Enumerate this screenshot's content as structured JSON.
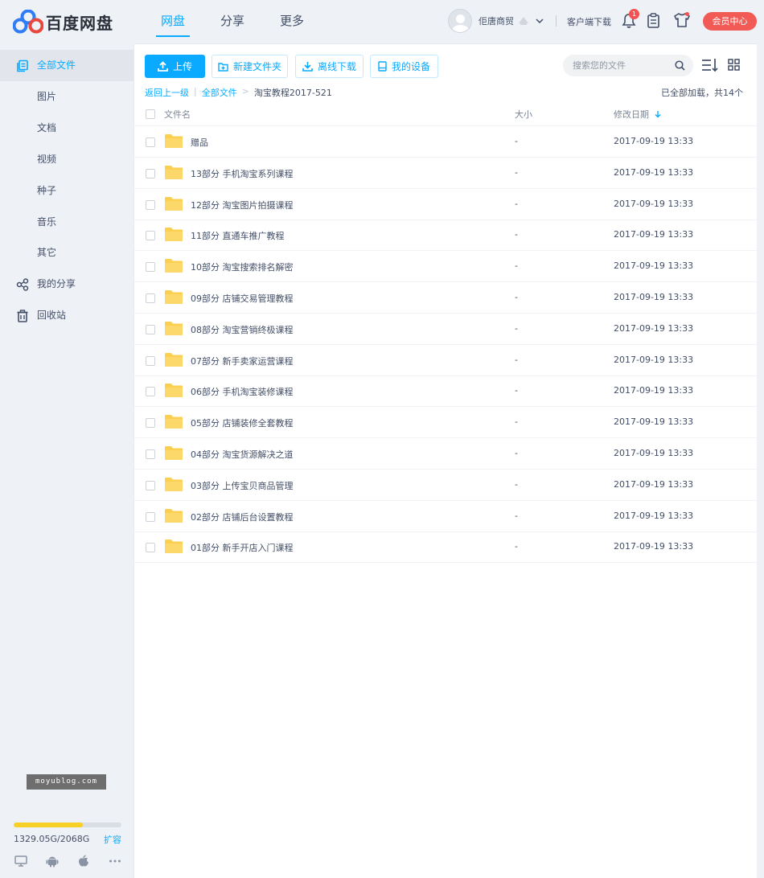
{
  "app": {
    "name": "百度网盘"
  },
  "nav": [
    {
      "label": "网盘"
    },
    {
      "label": "分享"
    },
    {
      "label": "更多"
    }
  ],
  "user": {
    "name": "佢唐商贸",
    "client_download": "客户端下载",
    "notification_count": "1",
    "vip_button": "会员中心"
  },
  "sidebar": {
    "items": [
      {
        "label": "全部文件",
        "icon": "all-files-icon",
        "active": true
      },
      {
        "label": "图片"
      },
      {
        "label": "文档"
      },
      {
        "label": "视频"
      },
      {
        "label": "种子"
      },
      {
        "label": "音乐"
      },
      {
        "label": "其它"
      },
      {
        "label": "我的分享",
        "icon": "share-icon"
      },
      {
        "label": "回收站",
        "icon": "trash-icon"
      }
    ],
    "watermark": "moyublog.com",
    "quota": {
      "text": "1329.05G/2068G",
      "used_fraction": 0.643,
      "expand_label": "扩容"
    }
  },
  "toolbar": {
    "upload": "上传",
    "new_folder": "新建文件夹",
    "offline_download": "离线下载",
    "my_devices": "我的设备",
    "search_placeholder": "搜索您的文件"
  },
  "breadcrumb": {
    "back": "返回上一级",
    "root": "全部文件",
    "current": "淘宝教程2017-521"
  },
  "status": {
    "loaded": "已全部加载，共14个"
  },
  "table": {
    "headers": {
      "name": "文件名",
      "size": "大小",
      "date": "修改日期"
    },
    "rows": [
      {
        "name": "赠品",
        "size": "-",
        "date": "2017-09-19 13:33"
      },
      {
        "name": "13部分 手机淘宝系列课程",
        "size": "-",
        "date": "2017-09-19 13:33"
      },
      {
        "name": "12部分 淘宝图片拍摄课程",
        "size": "-",
        "date": "2017-09-19 13:33"
      },
      {
        "name": "11部分 直通车推广教程",
        "size": "-",
        "date": "2017-09-19 13:33"
      },
      {
        "name": "10部分 淘宝搜索排名解密",
        "size": "-",
        "date": "2017-09-19 13:33"
      },
      {
        "name": "09部分 店铺交易管理教程",
        "size": "-",
        "date": "2017-09-19 13:33"
      },
      {
        "name": "08部分 淘宝营销终极课程",
        "size": "-",
        "date": "2017-09-19 13:33"
      },
      {
        "name": "07部分 新手卖家运营课程",
        "size": "-",
        "date": "2017-09-19 13:33"
      },
      {
        "name": "06部分 手机淘宝装修课程",
        "size": "-",
        "date": "2017-09-19 13:33"
      },
      {
        "name": "05部分 店铺装修全套教程",
        "size": "-",
        "date": "2017-09-19 13:33"
      },
      {
        "name": "04部分 淘宝货源解决之道",
        "size": "-",
        "date": "2017-09-19 13:33"
      },
      {
        "name": "03部分 上传宝贝商品管理",
        "size": "-",
        "date": "2017-09-19 13:33"
      },
      {
        "name": "02部分 店铺后台设置教程",
        "size": "-",
        "date": "2017-09-19 13:33"
      },
      {
        "name": "01部分 新手开店入门课程",
        "size": "-",
        "date": "2017-09-19 13:33"
      }
    ]
  },
  "colors": {
    "accent": "#09aaff",
    "vip": "#f25a55",
    "quota": "#f8cf24",
    "folder": "#fbcf4f"
  }
}
